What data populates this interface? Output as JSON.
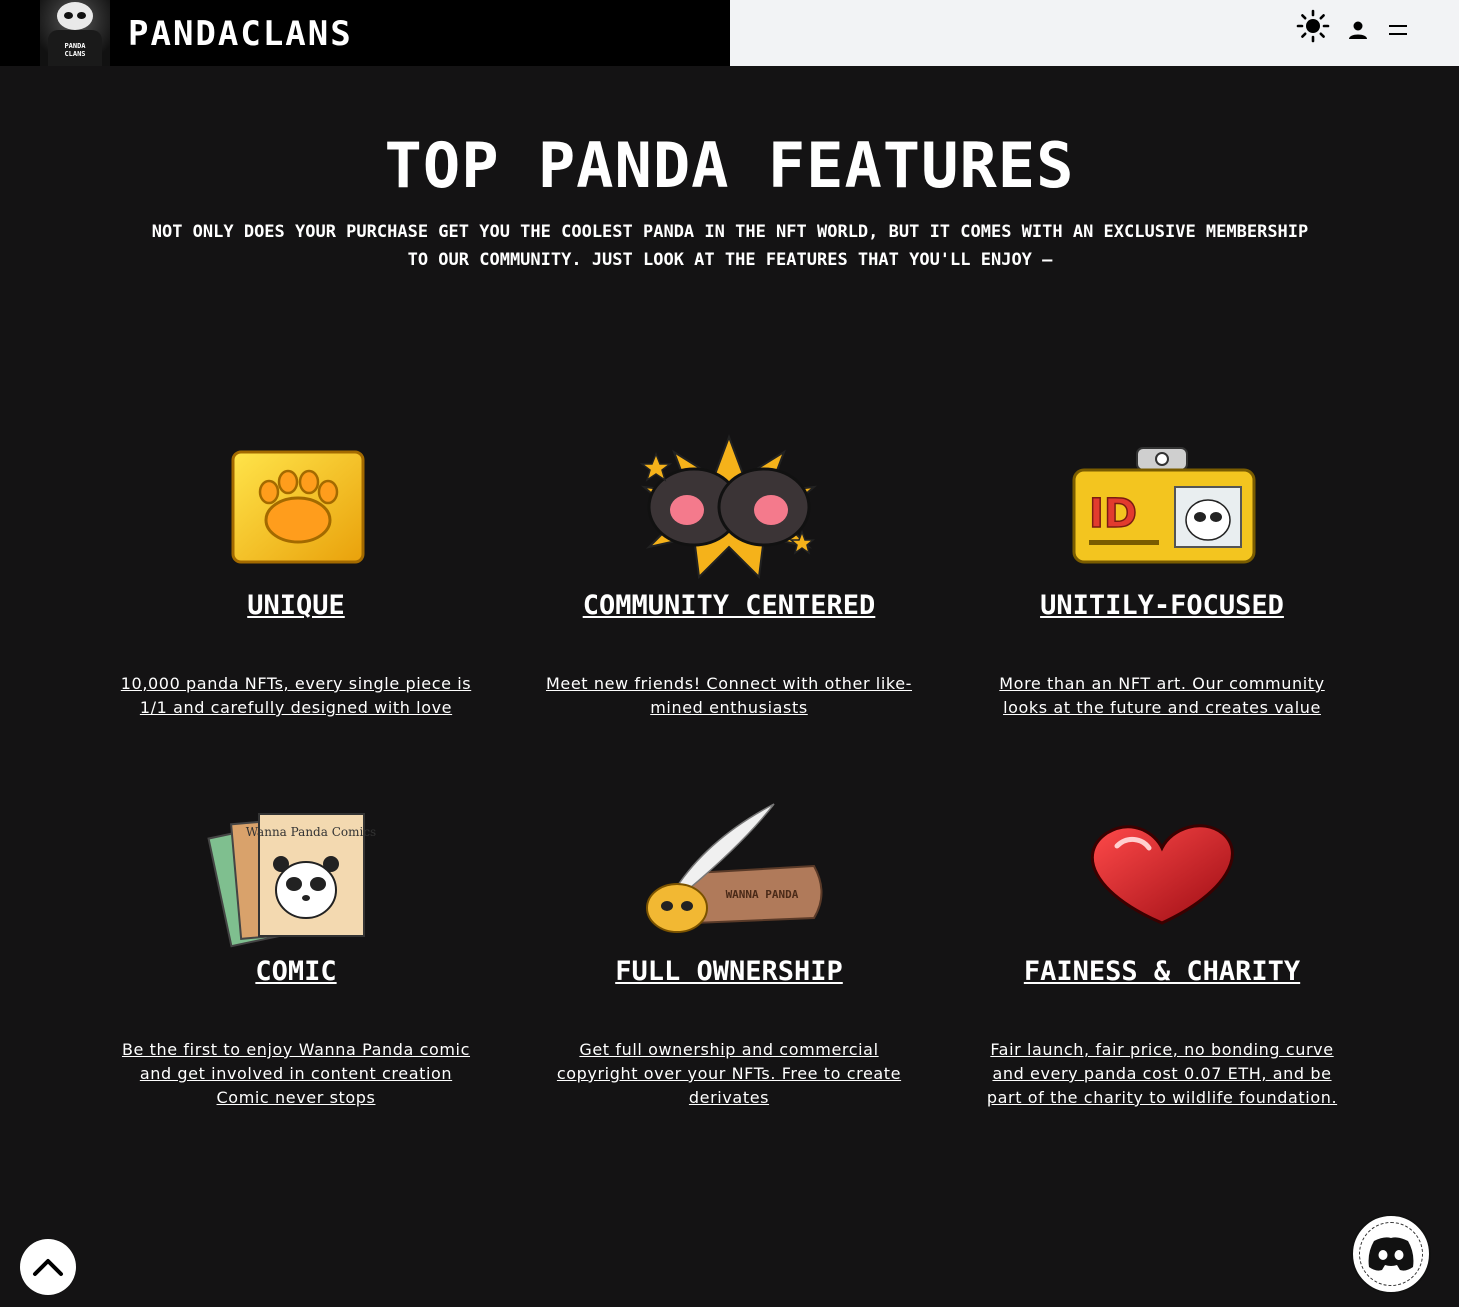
{
  "header": {
    "brand": "PANDACLANS",
    "logo_tag": "PANDA CLANS",
    "icons": [
      "sun-icon",
      "user-icon",
      "menu-icon"
    ]
  },
  "section": {
    "title": "Top Panda Features",
    "subtitle": "Not only does your purchase get you the coolest panda in the NFT world, but it comes with an exclusive membership to our community. Just look at the features that you'll enjoy —"
  },
  "features": [
    {
      "title": "Unique",
      "desc": "10,000 panda NFTs, every single piece is 1/1 and carefully designed with love",
      "image": "golden-paw-image"
    },
    {
      "title": "Community Centered",
      "desc": "Meet new friends! Connect with other like-mined enthusiasts",
      "image": "panda-paws-image"
    },
    {
      "title": "Unitily-Focused",
      "desc": "More than an NFT art. Our community looks at the future and creates value",
      "image": "id-card-image"
    },
    {
      "title": "Comic",
      "desc": "Be the first to enjoy Wanna Panda comic and get involved in content creation Comic never stops",
      "image": "comic-books-image",
      "image_text": "Wanna Panda Comics"
    },
    {
      "title": "Full Ownership",
      "desc": "Get full ownership and commercial copyright over your NFTs. Free to create derivates",
      "image": "quill-scroll-image",
      "image_text": "WANNA PANDA"
    },
    {
      "title": "Fainess & Charity",
      "desc": "Fair launch, fair price, no bonding curve and every panda cost 0.07 ETH, and be part of the charity to wildlife foundation.",
      "image": "red-heart-image"
    }
  ],
  "colors": {
    "background": "#141314",
    "header_left": "#000000",
    "header_right": "#f2f3f5",
    "text": "#ffffff"
  },
  "floating": {
    "scroll_top": "chevron-up-icon",
    "discord": "discord-icon"
  }
}
